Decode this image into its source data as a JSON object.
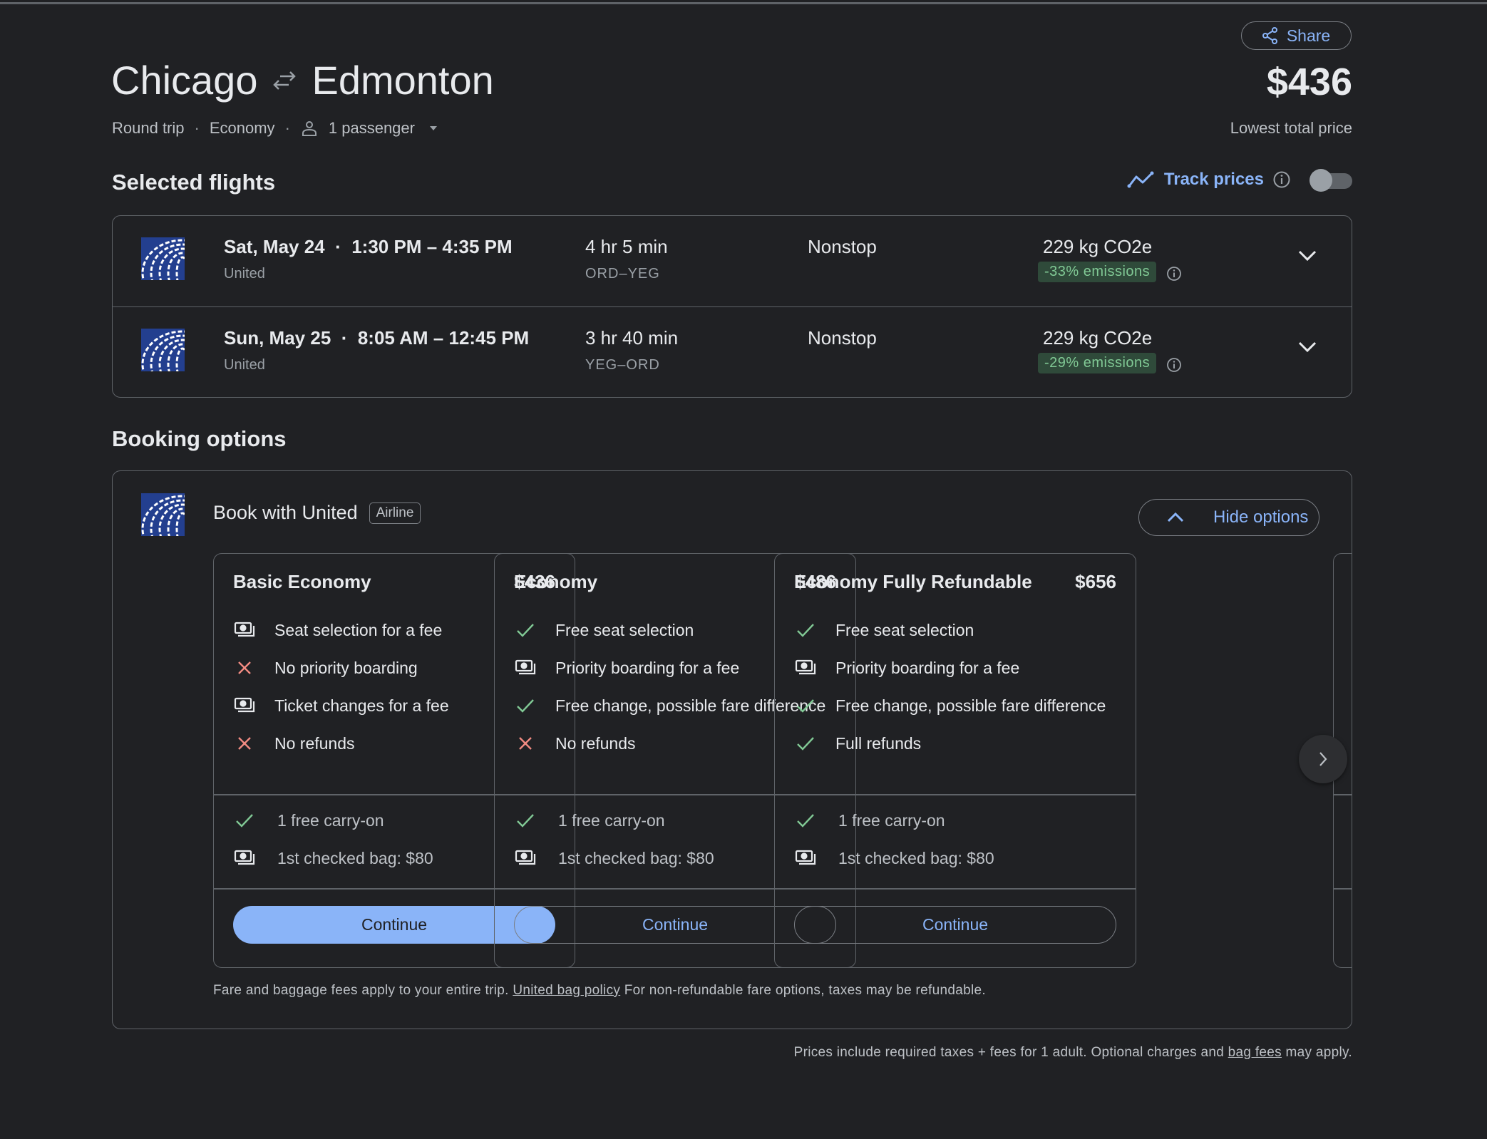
{
  "header": {
    "share_label": "Share",
    "origin": "Chicago",
    "destination": "Edmonton",
    "trip_type": "Round trip",
    "cabin": "Economy",
    "passengers": "1 passenger",
    "price": "$436",
    "price_caption": "Lowest total price"
  },
  "selected": {
    "heading": "Selected flights",
    "track_label": "Track prices",
    "track_enabled": false,
    "flights": [
      {
        "date": "Sat, May 24",
        "times": "1:30 PM – 4:35 PM",
        "airline": "United",
        "duration": "4 hr 5 min",
        "route": "ORD–YEG",
        "stops": "Nonstop",
        "co2": "229 kg CO2e",
        "emissions": "-33% emissions"
      },
      {
        "date": "Sun, May 25",
        "times": "8:05 AM – 12:45 PM",
        "airline": "United",
        "duration": "3 hr 40 min",
        "route": "YEG–ORD",
        "stops": "Nonstop",
        "co2": "229 kg CO2e",
        "emissions": "-29% emissions"
      }
    ]
  },
  "booking": {
    "heading": "Booking options",
    "provider": "Book with United",
    "provider_badge": "Airline",
    "hide_label": "Hide options",
    "fares": [
      {
        "name": "Basic Economy",
        "price": "$436",
        "primary": true,
        "features": [
          [
            "fee",
            "Seat selection for a fee"
          ],
          [
            "no",
            "No priority boarding"
          ],
          [
            "fee",
            "Ticket changes for a fee"
          ],
          [
            "no",
            "No refunds"
          ]
        ],
        "bags": [
          [
            "yes",
            "1 free carry-on"
          ],
          [
            "fee",
            "1st checked bag: $80"
          ]
        ],
        "button": "Continue"
      },
      {
        "name": "Economy",
        "price": "$486",
        "primary": false,
        "features": [
          [
            "yes",
            "Free seat selection"
          ],
          [
            "fee",
            "Priority boarding for a fee"
          ],
          [
            "yes",
            "Free change, possible fare difference"
          ],
          [
            "no",
            "No refunds"
          ]
        ],
        "bags": [
          [
            "yes",
            "1 free carry-on"
          ],
          [
            "fee",
            "1st checked bag: $80"
          ]
        ],
        "button": "Continue"
      },
      {
        "name": "Economy Fully Refundable",
        "price": "$656",
        "primary": false,
        "features": [
          [
            "yes",
            "Free seat selection"
          ],
          [
            "fee",
            "Priority boarding for a fee"
          ],
          [
            "yes",
            "Free change, possible fare difference"
          ],
          [
            "yes",
            "Full refunds"
          ]
        ],
        "bags": [
          [
            "yes",
            "1 free carry-on"
          ],
          [
            "fee",
            "1st checked bag: $80"
          ]
        ],
        "button": "Continue"
      }
    ],
    "fine_print_1": "Fare and baggage fees apply to your entire trip.",
    "fine_print_link": "United bag policy",
    "fine_print_2": " For non-refundable fare options, taxes may be refundable."
  },
  "footer": {
    "text_1": "Prices include required taxes + fees for 1 adult. Optional charges and ",
    "link": "bag fees",
    "text_2": " may apply."
  },
  "colors": {
    "accent": "#8ab4f8",
    "positive": "#81c995",
    "negative": "#f28b82",
    "background": "#202124",
    "united_blue": "#233f8f"
  }
}
